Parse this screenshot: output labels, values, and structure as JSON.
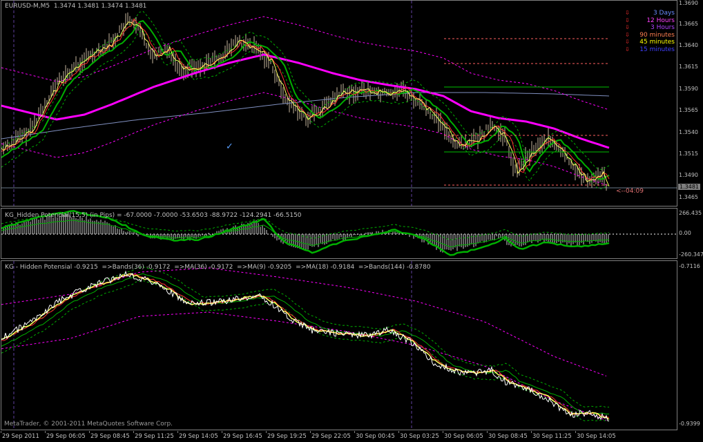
{
  "main": {
    "title": "EURUSD-M,M5  1.3474 1.3481 1.3474 1.3481",
    "current_price": "1.3481",
    "timer": "<--04:09",
    "price_scale": [
      "1.3690",
      "1.3665",
      "1.3640",
      "1.3615",
      "1.3590",
      "1.3565",
      "1.3540",
      "1.3515",
      "1.3490",
      "1.3465"
    ],
    "timeframes": [
      {
        "label": "3 Days",
        "color": "#6a8cff"
      },
      {
        "label": "12 Hours",
        "color": "#ff40ff"
      },
      {
        "label": "3 Hours",
        "color": "#b040ff"
      },
      {
        "label": "90 minutes",
        "color": "#ff7f50"
      },
      {
        "label": "45 minutes",
        "color": "#ffff00"
      },
      {
        "label": "15 minutes",
        "color": "#4040ff"
      }
    ],
    "arrow_glyph": "⇩"
  },
  "osc": {
    "title": "KG_Hidden Potencial(15,5) (in Pips) = -67.0000 -7.0000 -53.6503 -88.9722 -124.2941 -66.5150",
    "scale": [
      "266.435",
      "0.00",
      "-260.347"
    ]
  },
  "hp": {
    "title": "KG - Hidden Potensial -0.9215  =>Bands(36) -0.9172  =>MA(36) -0.9172  =>MA(9) -0.9205  =>MA(18) -0.9184  =>Bands(144) -0.8780",
    "scale": [
      "-0.7116",
      "-0.9399"
    ]
  },
  "copyright": "MetaTrader, © 2001-2011 MetaQuotes Software Corp.",
  "xaxis": [
    "29 Sep 2011",
    "29 Sep 06:05",
    "29 Sep 08:45",
    "29 Sep 11:25",
    "29 Sep 14:05",
    "29 Sep 16:45",
    "29 Sep 19:25",
    "29 Sep 22:05",
    "30 Sep 00:45",
    "30 Sep 03:25",
    "30 Sep 06:05",
    "30 Sep 08:45",
    "30 Sep 11:25",
    "30 Sep 14:05"
  ],
  "colors": {
    "magenta": "#ff00ff",
    "green": "#00b000",
    "price": "#c8b8a0",
    "yellow": "#ffff60",
    "red": "#ff3030",
    "white": "#ffffff",
    "steel": "#8090c0"
  }
}
